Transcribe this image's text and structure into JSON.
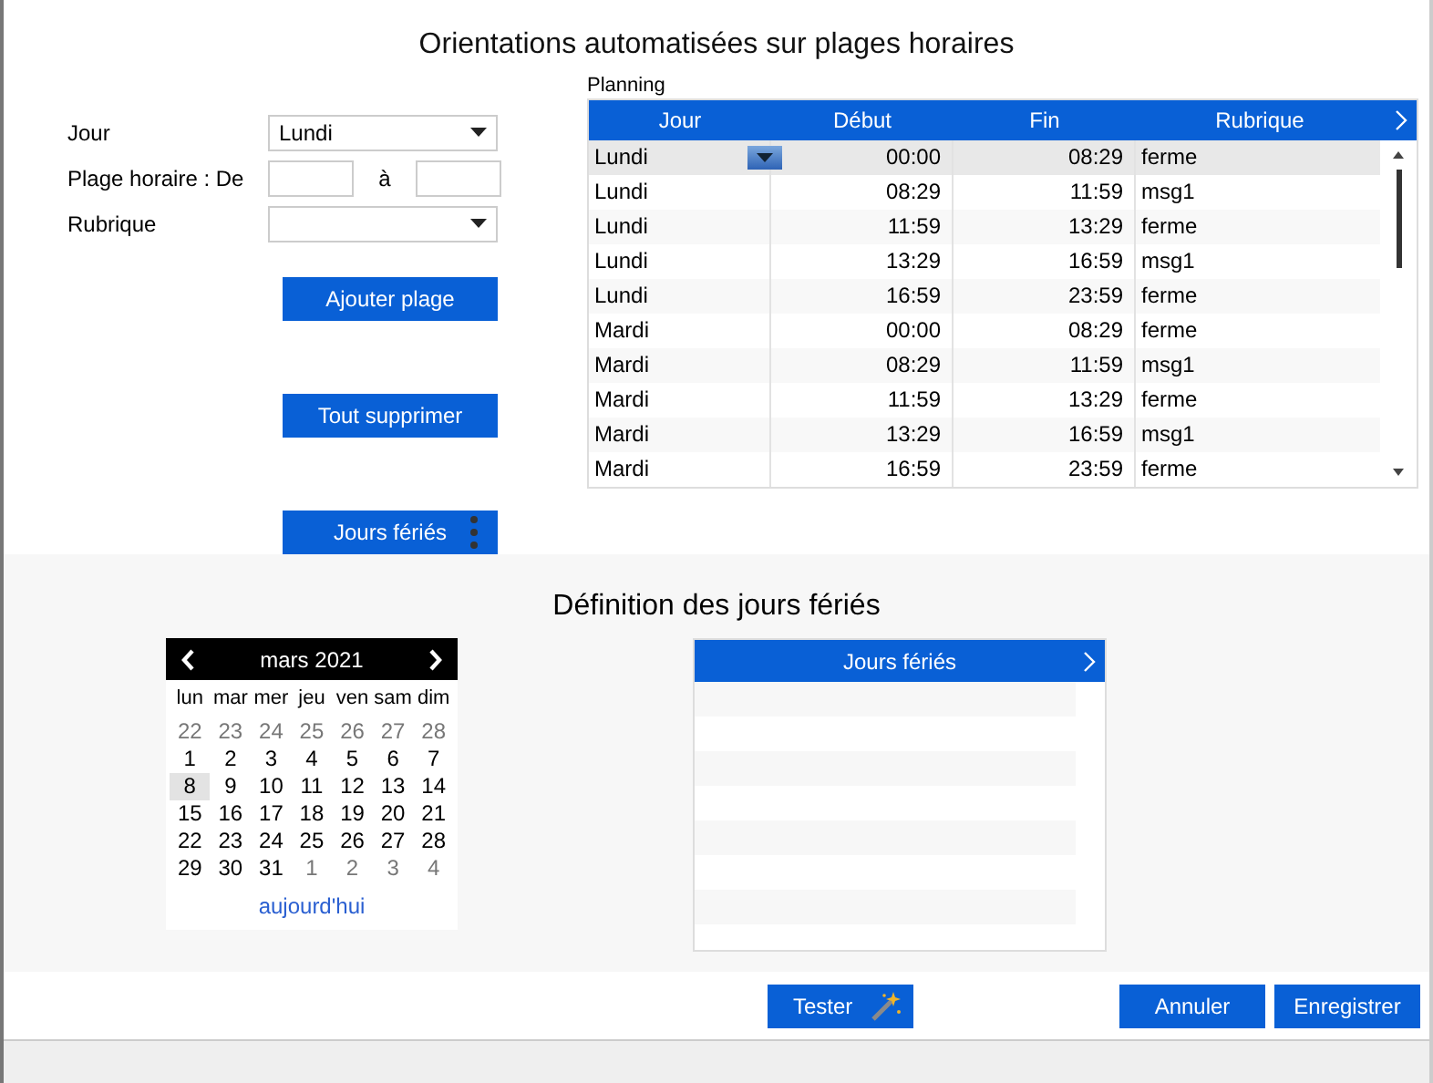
{
  "title": "Orientations automatisées sur plages horaires",
  "form": {
    "day_label": "Jour",
    "day_value": "Lundi",
    "range_label": "Plage horaire : De",
    "range_to": "à",
    "topic_label": "Rubrique"
  },
  "side_buttons": [
    "Ajouter plage",
    "Tout supprimer",
    "Jours fériés"
  ],
  "planning": {
    "label": "Planning",
    "columns": [
      "Jour",
      "Début",
      "Fin",
      "Rubrique"
    ],
    "rows": [
      {
        "day": "Lundi",
        "start": "00:00",
        "end": "08:29",
        "topic": "ferme",
        "selected": true
      },
      {
        "day": "Lundi",
        "start": "08:29",
        "end": "11:59",
        "topic": "msg1",
        "selected": false
      },
      {
        "day": "Lundi",
        "start": "11:59",
        "end": "13:29",
        "topic": "ferme",
        "selected": false
      },
      {
        "day": "Lundi",
        "start": "13:29",
        "end": "16:59",
        "topic": "msg1",
        "selected": false
      },
      {
        "day": "Lundi",
        "start": "16:59",
        "end": "23:59",
        "topic": "ferme",
        "selected": false
      },
      {
        "day": "Mardi",
        "start": "00:00",
        "end": "08:29",
        "topic": "ferme",
        "selected": false
      },
      {
        "day": "Mardi",
        "start": "08:29",
        "end": "11:59",
        "topic": "msg1",
        "selected": false
      },
      {
        "day": "Mardi",
        "start": "11:59",
        "end": "13:29",
        "topic": "ferme",
        "selected": false
      },
      {
        "day": "Mardi",
        "start": "13:29",
        "end": "16:59",
        "topic": "msg1",
        "selected": false
      },
      {
        "day": "Mardi",
        "start": "16:59",
        "end": "23:59",
        "topic": "ferme",
        "selected": false
      }
    ]
  },
  "holidays_title": "Définition des jours fériés",
  "calendar": {
    "month": "mars 2021",
    "weekdays": [
      "lun",
      "mar",
      "mer",
      "jeu",
      "ven",
      "sam",
      "dim"
    ],
    "weeks": [
      [
        {
          "d": "22",
          "outside": true,
          "selected": false
        },
        {
          "d": "23",
          "outside": true,
          "selected": false
        },
        {
          "d": "24",
          "outside": true,
          "selected": false
        },
        {
          "d": "25",
          "outside": true,
          "selected": false
        },
        {
          "d": "26",
          "outside": true,
          "selected": false
        },
        {
          "d": "27",
          "outside": true,
          "selected": false
        },
        {
          "d": "28",
          "outside": true,
          "selected": false
        }
      ],
      [
        {
          "d": "1",
          "outside": false,
          "selected": false
        },
        {
          "d": "2",
          "outside": false,
          "selected": false
        },
        {
          "d": "3",
          "outside": false,
          "selected": false
        },
        {
          "d": "4",
          "outside": false,
          "selected": false
        },
        {
          "d": "5",
          "outside": false,
          "selected": false
        },
        {
          "d": "6",
          "outside": false,
          "selected": false
        },
        {
          "d": "7",
          "outside": false,
          "selected": false
        }
      ],
      [
        {
          "d": "8",
          "outside": false,
          "selected": true
        },
        {
          "d": "9",
          "outside": false,
          "selected": false
        },
        {
          "d": "10",
          "outside": false,
          "selected": false
        },
        {
          "d": "11",
          "outside": false,
          "selected": false
        },
        {
          "d": "12",
          "outside": false,
          "selected": false
        },
        {
          "d": "13",
          "outside": false,
          "selected": false
        },
        {
          "d": "14",
          "outside": false,
          "selected": false
        }
      ],
      [
        {
          "d": "15",
          "outside": false,
          "selected": false
        },
        {
          "d": "16",
          "outside": false,
          "selected": false
        },
        {
          "d": "17",
          "outside": false,
          "selected": false
        },
        {
          "d": "18",
          "outside": false,
          "selected": false
        },
        {
          "d": "19",
          "outside": false,
          "selected": false
        },
        {
          "d": "20",
          "outside": false,
          "selected": false
        },
        {
          "d": "21",
          "outside": false,
          "selected": false
        }
      ],
      [
        {
          "d": "22",
          "outside": false,
          "selected": false
        },
        {
          "d": "23",
          "outside": false,
          "selected": false
        },
        {
          "d": "24",
          "outside": false,
          "selected": false
        },
        {
          "d": "25",
          "outside": false,
          "selected": false
        },
        {
          "d": "26",
          "outside": false,
          "selected": false
        },
        {
          "d": "27",
          "outside": false,
          "selected": false
        },
        {
          "d": "28",
          "outside": false,
          "selected": false
        }
      ],
      [
        {
          "d": "29",
          "outside": false,
          "selected": false
        },
        {
          "d": "30",
          "outside": false,
          "selected": false
        },
        {
          "d": "31",
          "outside": false,
          "selected": false
        },
        {
          "d": "1",
          "outside": true,
          "selected": false
        },
        {
          "d": "2",
          "outside": true,
          "selected": false
        },
        {
          "d": "3",
          "outside": true,
          "selected": false
        },
        {
          "d": "4",
          "outside": true,
          "selected": false
        }
      ]
    ],
    "today": "aujourd'hui"
  },
  "holiday_list": {
    "column": "Jours fériés"
  },
  "buttons": {
    "test": "Tester",
    "cancel": "Annuler",
    "save": "Enregistrer"
  }
}
